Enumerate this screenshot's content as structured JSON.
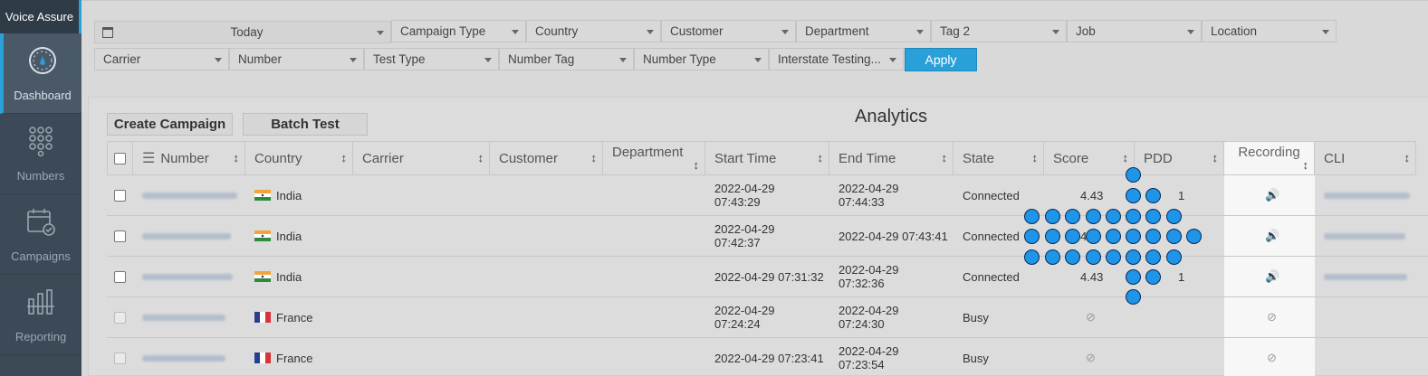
{
  "brand": "Voice Assure",
  "sidebar": {
    "items": [
      {
        "label": "Dashboard",
        "icon": "dashboard-icon",
        "active": true
      },
      {
        "label": "Numbers",
        "icon": "keypad-icon",
        "active": false
      },
      {
        "label": "Campaigns",
        "icon": "calendar-icon",
        "active": false
      },
      {
        "label": "Reporting",
        "icon": "reporting-icon",
        "active": false
      }
    ]
  },
  "filters": {
    "date": "Today",
    "campaign_type": "Campaign Type",
    "country": "Country",
    "customer": "Customer",
    "department": "Department",
    "tag2": "Tag 2",
    "job": "Job",
    "location": "Location",
    "carrier": "Carrier",
    "number": "Number",
    "test_type": "Test Type",
    "number_tag": "Number Tag",
    "number_type": "Number Type",
    "interstate": "Interstate Testing..."
  },
  "apply_label": "Apply",
  "panel": {
    "create_campaign": "Create Campaign",
    "batch_test": "Batch Test",
    "title": "Analytics"
  },
  "table": {
    "headers": {
      "number": "Number",
      "country": "Country",
      "carrier": "Carrier",
      "customer": "Customer",
      "department": "Department",
      "start_time": "Start Time",
      "end_time": "End Time",
      "state": "State",
      "score": "Score",
      "pdd": "PDD",
      "recording": "Recording",
      "cli": "CLI"
    },
    "rows": [
      {
        "country": "India",
        "start_date": "2022-04-29",
        "start_time": "07:43:29",
        "end_date": "2022-04-29",
        "end_time": "07:44:33",
        "state": "Connected",
        "score": "4.43",
        "pdd": "1"
      },
      {
        "country": "India",
        "start_date": "2022-04-29",
        "start_time": "07:42:37",
        "end_full": "2022-04-29 07:43:41",
        "state": "Connected",
        "score": "4.",
        "pdd": ""
      },
      {
        "country": "India",
        "start_full": "2022-04-29 07:31:32",
        "end_date": "2022-04-29",
        "end_time": "07:32:36",
        "state": "Connected",
        "score": "4.43",
        "pdd": "1"
      },
      {
        "country": "France",
        "start_date": "2022-04-29",
        "start_time": "07:24:24",
        "end_date": "2022-04-29",
        "end_time": "07:24:30",
        "state": "Busy"
      },
      {
        "country": "France",
        "start_full": "2022-04-29 07:23:41",
        "end_date": "2022-04-29",
        "end_time": "07:23:54",
        "state": "Busy"
      }
    ]
  },
  "icons": {
    "sort": "↕",
    "speaker": "🔊",
    "na": "⊘"
  },
  "colors": {
    "accent": "#2aa0d9",
    "sidebar": "#3c4a58",
    "speaker": "#f08b1a",
    "dot": "#1e95e8"
  }
}
